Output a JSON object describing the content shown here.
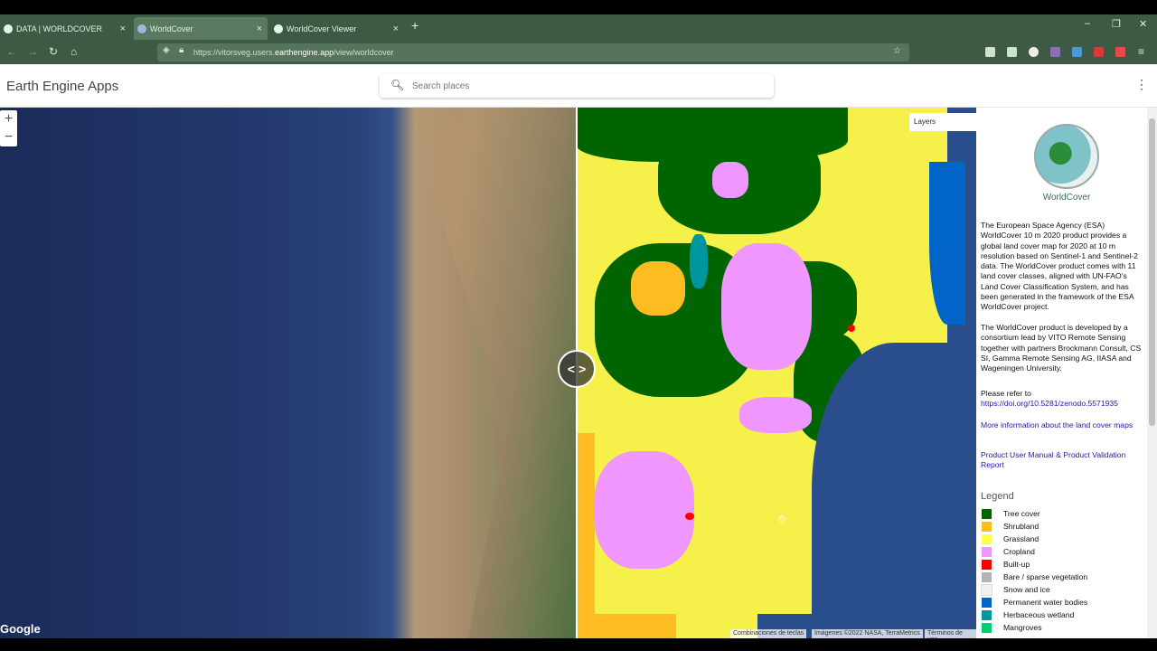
{
  "browser": {
    "tabs": [
      {
        "label": "DATA | WORLDCOVER",
        "active": false
      },
      {
        "label": "WorldCover",
        "active": true
      },
      {
        "label": "WorldCover Viewer",
        "active": false
      }
    ],
    "tab_close": "×",
    "new_tab": "+",
    "url_prefix": "https://vitorsveg.users.",
    "url_host": "earthengine.app",
    "url_suffix": "/view/worldcover",
    "window_controls": [
      "–",
      "❐",
      "✕"
    ]
  },
  "app": {
    "title": "Earth Engine Apps",
    "search_placeholder": "Search places"
  },
  "map": {
    "zoom_in": "+",
    "zoom_out": "−",
    "layers_label": "Layers",
    "splitter_label": "< >",
    "google_logo": "Google",
    "attributions": [
      "Combinaciones de teclas",
      "Imágenes ©2022 NASA, TerraMetrics",
      "Términos de uso"
    ]
  },
  "panel": {
    "logo_text": "WorldCover",
    "description_1": "The European Space Agency (ESA) WorldCover 10 m 2020 product provides a global land cover map for 2020 at 10 m resolution based on Sentinel-1 and Sentinel-2 data. The WorldCover product comes with 11 land cover classes, aligned with UN-FAO's Land Cover Classification System, and has been generated in the framework of the ESA WorldCover project.",
    "description_2": "The WorldCover product is developed by a consortium lead by VITO Remote Sensing together with partners Brockmann Consult, CS SI, Gamma Remote Sensing AG, IIASA and Wageningen University.",
    "refer_label": "Please refer to",
    "doi_link": "https://doi.org/10.5281/zenodo.5571935",
    "more_info_link": "More information about the land cover maps",
    "manual_link": "Product User Manual & Product Validation Report",
    "legend_title": "Legend",
    "legend": [
      {
        "label": "Tree cover",
        "color": "#006400"
      },
      {
        "label": "Shrubland",
        "color": "#ffbb22"
      },
      {
        "label": "Grassland",
        "color": "#ffff4c"
      },
      {
        "label": "Cropland",
        "color": "#f096ff"
      },
      {
        "label": "Built-up",
        "color": "#fa0000"
      },
      {
        "label": "Bare / sparse vegetation",
        "color": "#b4b4b4"
      },
      {
        "label": "Snow and ice",
        "color": "#f0f0f0"
      },
      {
        "label": "Permanent water bodies",
        "color": "#0064c8"
      },
      {
        "label": "Herbaceous wetland",
        "color": "#0096a0"
      },
      {
        "label": "Mangroves",
        "color": "#00cf75"
      }
    ]
  }
}
